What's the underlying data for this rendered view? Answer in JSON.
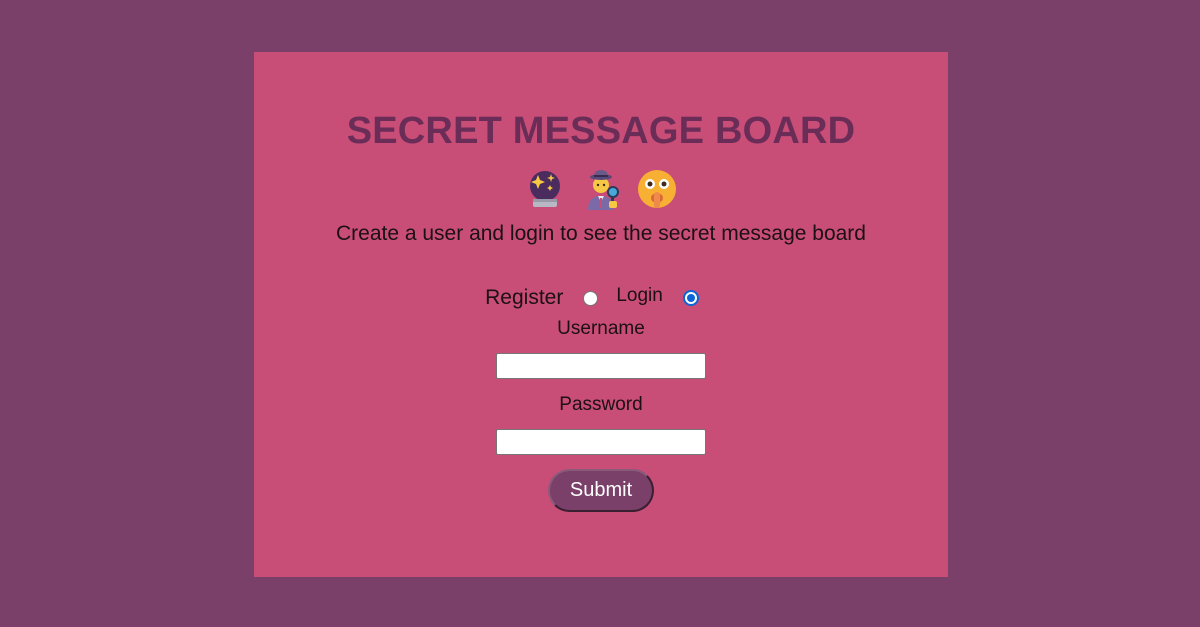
{
  "header": {
    "title": "SECRET MESSAGE BOARD",
    "subtitle": "Create a user and login to see the secret message board"
  },
  "emojis": [
    "crystal-ball-icon",
    "detective-icon",
    "shushing-face-icon"
  ],
  "form": {
    "mode_register_label": "Register",
    "mode_login_label": "Login",
    "selected_mode": "Login",
    "username_label": "Username",
    "username_value": "",
    "password_label": "Password",
    "password_value": "",
    "submit_label": "Submit"
  },
  "colors": {
    "background": "#7a4069",
    "card": "#c84d77",
    "title": "#6a2d57",
    "button": "#7a4069",
    "radio_selected": "#0a66d8"
  }
}
